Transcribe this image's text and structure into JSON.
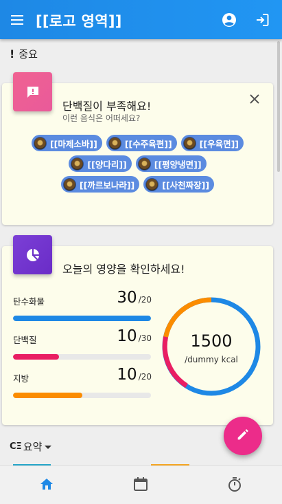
{
  "appbar": {
    "title": "[[로고 영역]]",
    "menu_icon": "menu-icon",
    "account_icon": "account-circle-icon",
    "logout_icon": "logout-icon"
  },
  "important_section": {
    "label": "중요",
    "icon": "exclamation-icon"
  },
  "protein_card": {
    "title": "단백질이 부족해요!",
    "subtitle": "이런 음식은 어떠세요?",
    "icon": "alert-message-icon",
    "close_icon": "close-icon",
    "foods": [
      "[[마제소바]]",
      "[[수주육편]]",
      "[[우육면]]",
      "[[양다리]]",
      "[[평양냉면]]",
      "[[까르보나라]]",
      "[[사천짜장]]"
    ]
  },
  "nutrition_card": {
    "title": "오늘의 영양을 확인하세요!",
    "icon": "pie-chart-icon",
    "nutrients": [
      {
        "label": "탄수화물",
        "value": "30",
        "max": "/20",
        "ratio": 1.0,
        "color": "#1e88e5"
      },
      {
        "label": "단백질",
        "value": "10",
        "max": "/30",
        "ratio": 0.333,
        "color": "#e91e63"
      },
      {
        "label": "지방",
        "value": "10",
        "max": "/20",
        "ratio": 0.5,
        "color": "#fb8c00"
      }
    ],
    "calories": {
      "value": "1500",
      "unit": "/dummy kcal"
    }
  },
  "summary_section": {
    "label": "요약",
    "icon": "summary-icon",
    "dropdown_icon": "arrow-drop-down-icon"
  },
  "fab": {
    "icon": "pencil-icon"
  },
  "bottom_nav": {
    "items": [
      "home-icon",
      "calendar-icon",
      "timer-icon"
    ],
    "active_color": "#1e88e5"
  }
}
